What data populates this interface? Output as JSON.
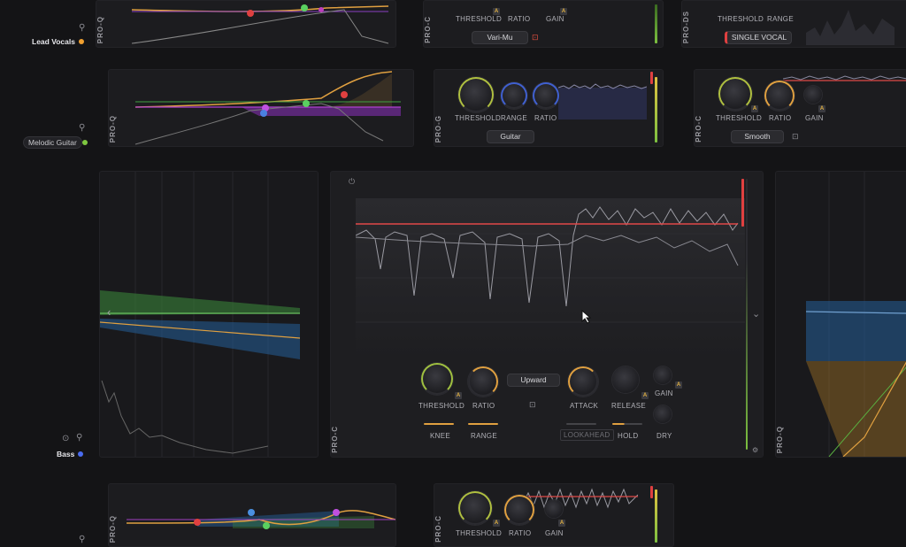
{
  "tracks": {
    "lead_vocals": {
      "label": "Lead Vocals",
      "color": "#f0a030"
    },
    "melodic_guitar": {
      "label": "Melodic Guitar",
      "color": "#7ec840"
    },
    "bass": {
      "label": "Bass",
      "color": "#4a6cf0"
    }
  },
  "plugins": {
    "pro_q": "PRO-Q",
    "pro_c": "PRO-C",
    "pro_ds": "PRO-DS"
  },
  "row1": {
    "proc": {
      "threshold": "THRESHOLD",
      "ratio": "RATIO",
      "gain": "GAIN",
      "style": "Vari-Mu"
    },
    "prods": {
      "threshold": "THRESHOLD",
      "range": "RANGE",
      "mode": "SINGLE VOCAL"
    }
  },
  "row2": {
    "prog": {
      "threshold": "THRESHOLD",
      "range": "RANGE",
      "ratio": "RATIO",
      "style": "Guitar"
    },
    "proc": {
      "threshold": "THRESHOLD",
      "ratio": "RATIO",
      "gain": "GAIN",
      "style": "Smooth"
    }
  },
  "main": {
    "threshold": "THRESHOLD",
    "ratio": "RATIO",
    "mode": "Upward",
    "attack": "ATTACK",
    "release": "RELEASE",
    "gain": "GAIN",
    "knee": "KNEE",
    "range": "RANGE",
    "lookahead": "LOOKAHEAD",
    "hold": "HOLD",
    "dry": "DRY"
  },
  "row4": {
    "proc": {
      "threshold": "THRESHOLD",
      "ratio": "RATIO",
      "gain": "GAIN"
    }
  },
  "colors": {
    "accent": "#e8a040",
    "threshold_line": "#e04848",
    "meter_green": "#7cc040"
  }
}
